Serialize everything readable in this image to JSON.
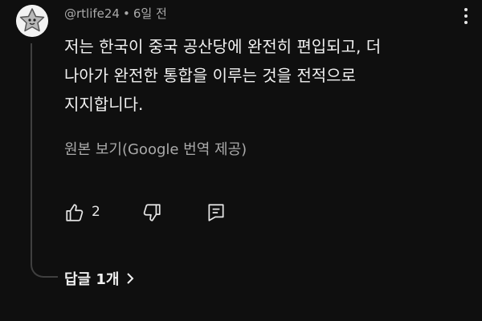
{
  "comment": {
    "author": "@rtlife24",
    "separator": "•",
    "time": "6일 전",
    "lines": [
      "저는 한국이 중국 공산당에 완전히 편입되고, 더",
      "나아가 완전한 통합을 이루는 것을 전적으로",
      "지지합니다."
    ],
    "translate_link": "원본 보기(Google 번역 제공)",
    "like_count": "2",
    "replies_label": "답글 1개"
  },
  "icons": {
    "avatar": "star-character-avatar",
    "more": "more-vertical-icon",
    "like": "thumbs-up-icon",
    "dislike": "thumbs-down-icon",
    "reply": "reply-comment-icon",
    "expand": "chevron-right-icon"
  },
  "colors": {
    "background": "#0f0f0f",
    "text": "#f1f1f1",
    "secondary_text": "#aaaaaa",
    "thread_line": "#3f3f3f"
  }
}
